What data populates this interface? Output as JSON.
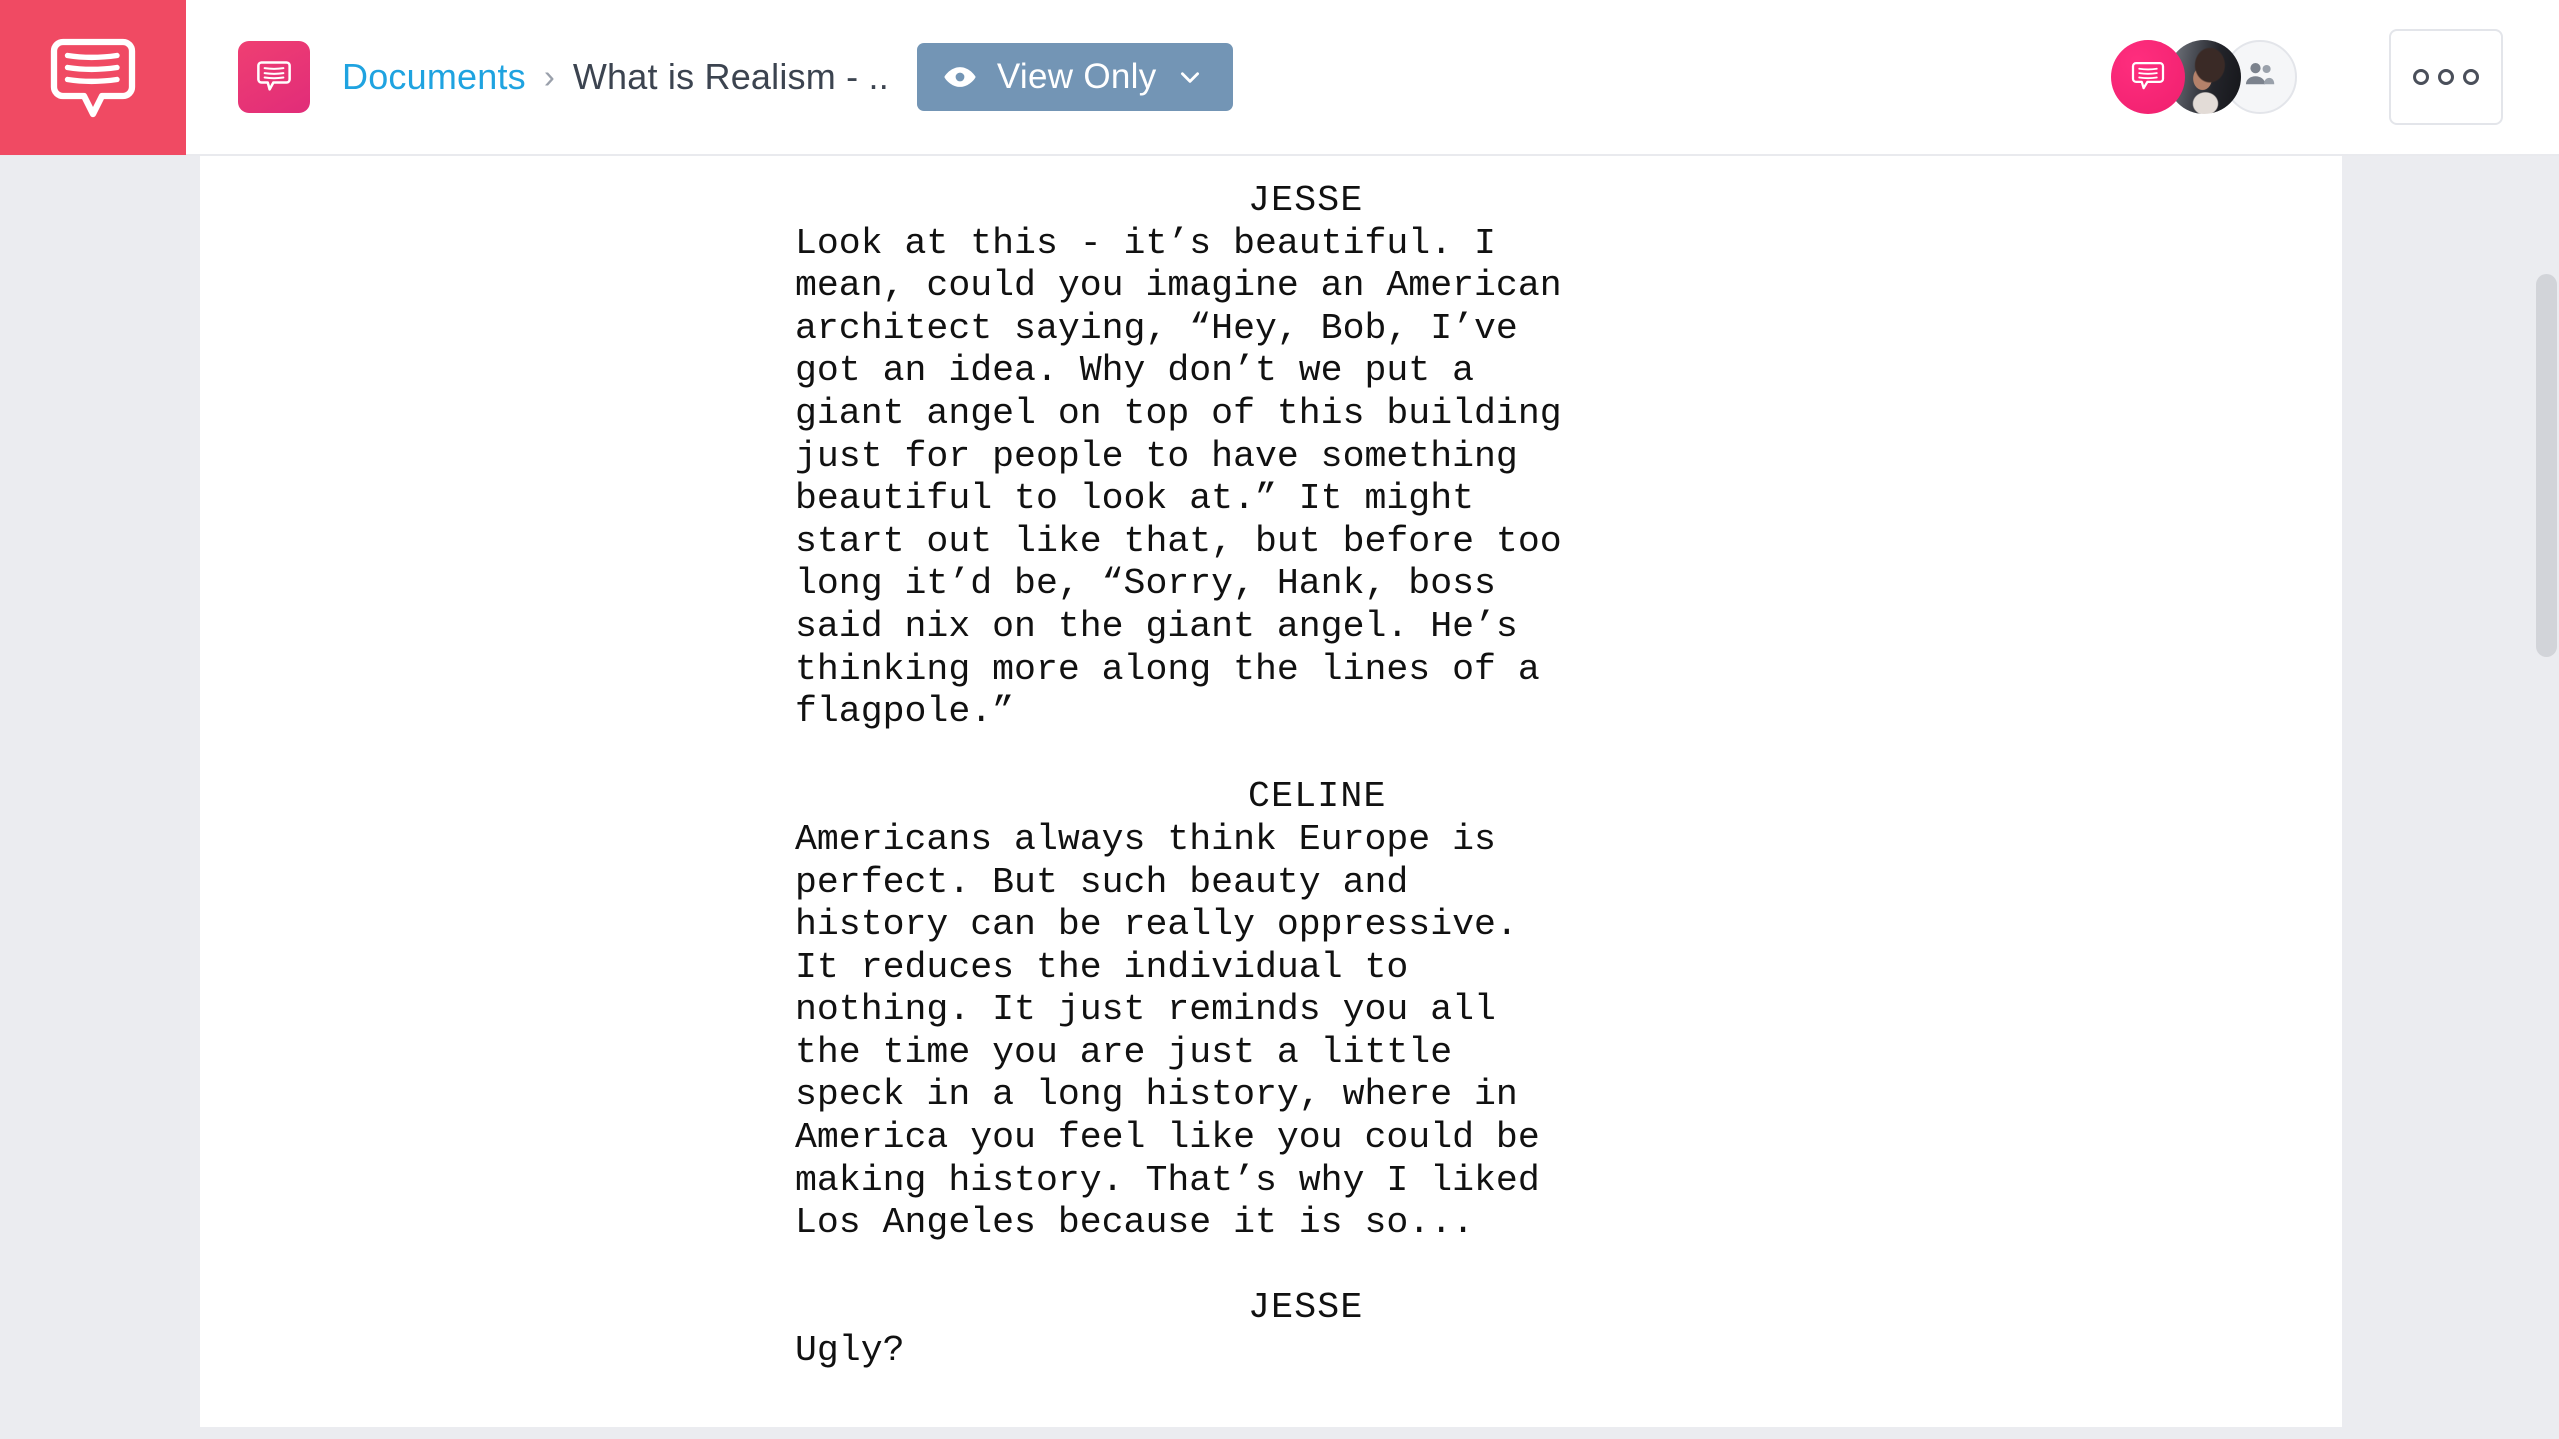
{
  "header": {
    "logo_icon": "script-bubble-logo-icon",
    "breadcrumb": {
      "icon": "document-bubble-icon",
      "root_label": "Documents",
      "separator": "›",
      "current_label": "What is Realism - .."
    },
    "view_only": {
      "icon": "eye-icon",
      "label": "View Only",
      "chevron": "chevron-down-icon",
      "color": "#7395b5"
    },
    "avatars": [
      {
        "name": "brand-avatar",
        "type": "logo"
      },
      {
        "name": "user-avatar-photo",
        "type": "photo"
      },
      {
        "name": "other-collaborators-avatar",
        "type": "people-icon"
      }
    ],
    "more_button": {
      "icon": "three-dots-icon",
      "dots": 3
    },
    "colors": {
      "logo_tile": "#f04a63",
      "breadcrumb_link": "#1fa3e0",
      "header_background": "#ffffff",
      "canvas_background": "#ebecf0"
    }
  },
  "document": {
    "page_background": "#ffffff",
    "blocks": [
      {
        "type": "character",
        "text": "JESSE"
      },
      {
        "type": "dialogue",
        "text": "Look at this - it’s beautiful. I\nmean, could you imagine an American\narchitect saying, “Hey, Bob, I’ve\ngot an idea. Why don’t we put a\ngiant angel on top of this building\njust for people to have something\nbeautiful to look at.” It might\nstart out like that, but before too\nlong it’d be, “Sorry, Hank, boss\nsaid nix on the giant angel. He’s\nthinking more along the lines of a\nflagpole.”"
      },
      {
        "type": "blank",
        "text": ""
      },
      {
        "type": "character",
        "text": "CELINE"
      },
      {
        "type": "dialogue",
        "text": "Americans always think Europe is\nperfect. But such beauty and\nhistory can be really oppressive.\nIt reduces the individual to\nnothing. It just reminds you all\nthe time you are just a little\nspeck in a long history, where in\nAmerica you feel like you could be\nmaking history. That’s why I liked\nLos Angeles because it is so..."
      },
      {
        "type": "blank",
        "text": ""
      },
      {
        "type": "character",
        "text": "JESSE"
      },
      {
        "type": "dialogue",
        "text": "Ugly?"
      }
    ]
  },
  "scrollbar": {
    "name": "vertical-scrollbar",
    "thumb_color": "#d2d4d9",
    "track_color": "#ebecf0"
  }
}
